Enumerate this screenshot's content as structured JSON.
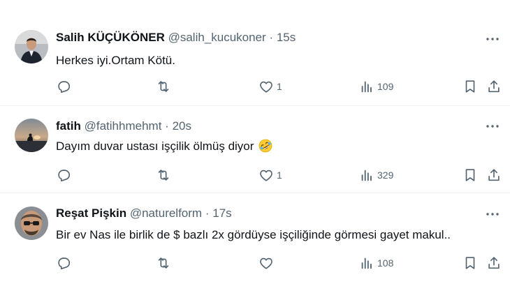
{
  "tweets": [
    {
      "name": "Salih KÜÇÜKÖNER",
      "handle": "@salih_kucukoner",
      "time": "15s",
      "text": "Herkes iyi.Ortam Kötü.",
      "likes": "1",
      "views": "109",
      "replies": "",
      "retweets": ""
    },
    {
      "name": "fatih",
      "handle": "@fatihhmehmt",
      "time": "20s",
      "text": "Dayım duvar ustası işçilik ölmüş diyor",
      "emoji": "rolling-on-floor-laughing-emoji",
      "likes": "1",
      "views": "329"
    },
    {
      "name": "Reşat Pişkin",
      "handle": "@naturelform",
      "time": "17s",
      "text": "Bir ev Nas ile birlik de $ bazlı 2x gördüyse işçiliğinde görmesi gayet makul..",
      "likes": "",
      "views": "108"
    }
  ],
  "separator": "·",
  "colors": {
    "text": "#0f1419",
    "muted": "#536471",
    "divider": "#eff3f4"
  }
}
